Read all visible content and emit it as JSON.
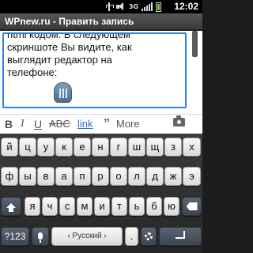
{
  "status_bar": {
    "network": "3G",
    "time": "12:02",
    "icons": [
      "usb-icon",
      "mute-icon",
      "signal-icon",
      "battery-icon"
    ]
  },
  "title": "WPnew.ru - Править запись",
  "editor": {
    "lines": [
      "html кодом. В следующем",
      "скриншоте Вы видите, как",
      "выглядит редактор на",
      "телефоне:"
    ]
  },
  "format_toolbar": {
    "bold": "B",
    "italic": "I",
    "underline": "U",
    "strike": "ABC",
    "link": "link",
    "quote": "”",
    "more": "More",
    "camera_icon": "camera-icon"
  },
  "keyboard": {
    "row1": [
      "й",
      "ц",
      "у",
      "к",
      "е",
      "н",
      "г",
      "ш",
      "щ",
      "з",
      "х"
    ],
    "row2": [
      "ф",
      "ы",
      "в",
      "а",
      "п",
      "р",
      "о",
      "л",
      "д",
      "ж",
      "э"
    ],
    "row3": [
      "я",
      "ч",
      "с",
      "м",
      "и",
      "т",
      "ь",
      "б",
      "ю"
    ],
    "symbols_key": "?123",
    "language_key": "‹ Русский ›",
    "dot_key": ".",
    "accent_color": "#2f82d9"
  }
}
